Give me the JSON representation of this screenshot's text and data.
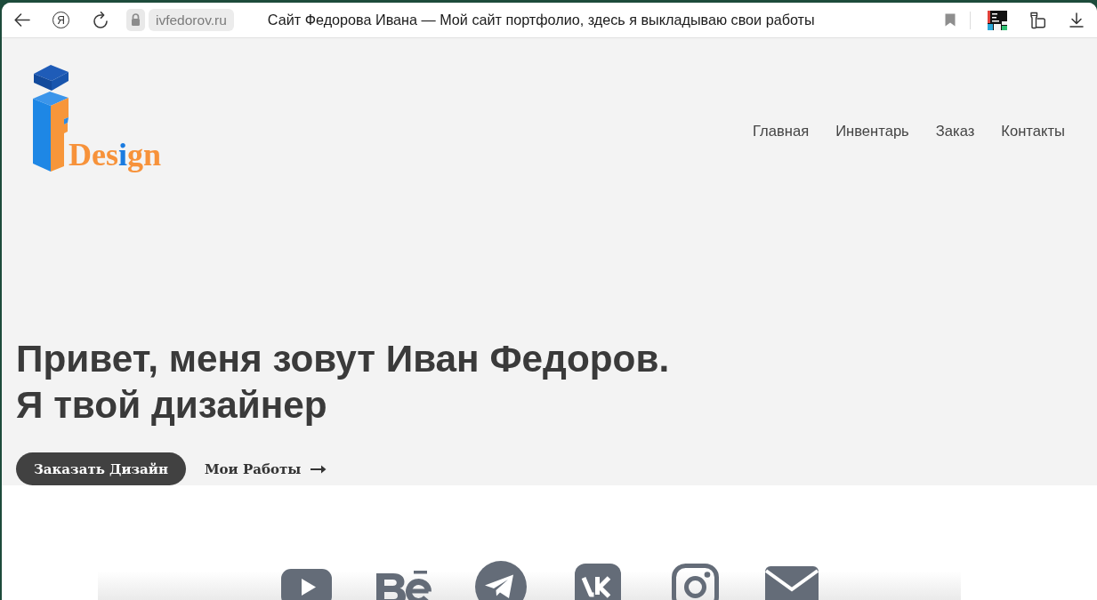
{
  "browser": {
    "ya_button": "Я",
    "url": "ivfedorov.ru",
    "page_title": "Сайт Федорова Ивана — Мой сайт портфолио, здесь я выкладываю свои работы"
  },
  "header": {
    "logo_parts": [
      {
        "text": "Des",
        "color": "#f7923a"
      },
      {
        "text": "i",
        "color": "#1a7be0"
      },
      {
        "text": "gn",
        "color": "#f7923a"
      }
    ],
    "nav": [
      {
        "label": "Главная"
      },
      {
        "label": "Инвентарь"
      },
      {
        "label": "Заказ"
      },
      {
        "label": "Контакты"
      }
    ]
  },
  "hero": {
    "heading_lines": [
      "Привет, меня зовут Иван Федоров.",
      "Я твой дизайнер"
    ],
    "primary_button": "Заказать Дизайн",
    "secondary_link": "Мои Работы"
  }
}
